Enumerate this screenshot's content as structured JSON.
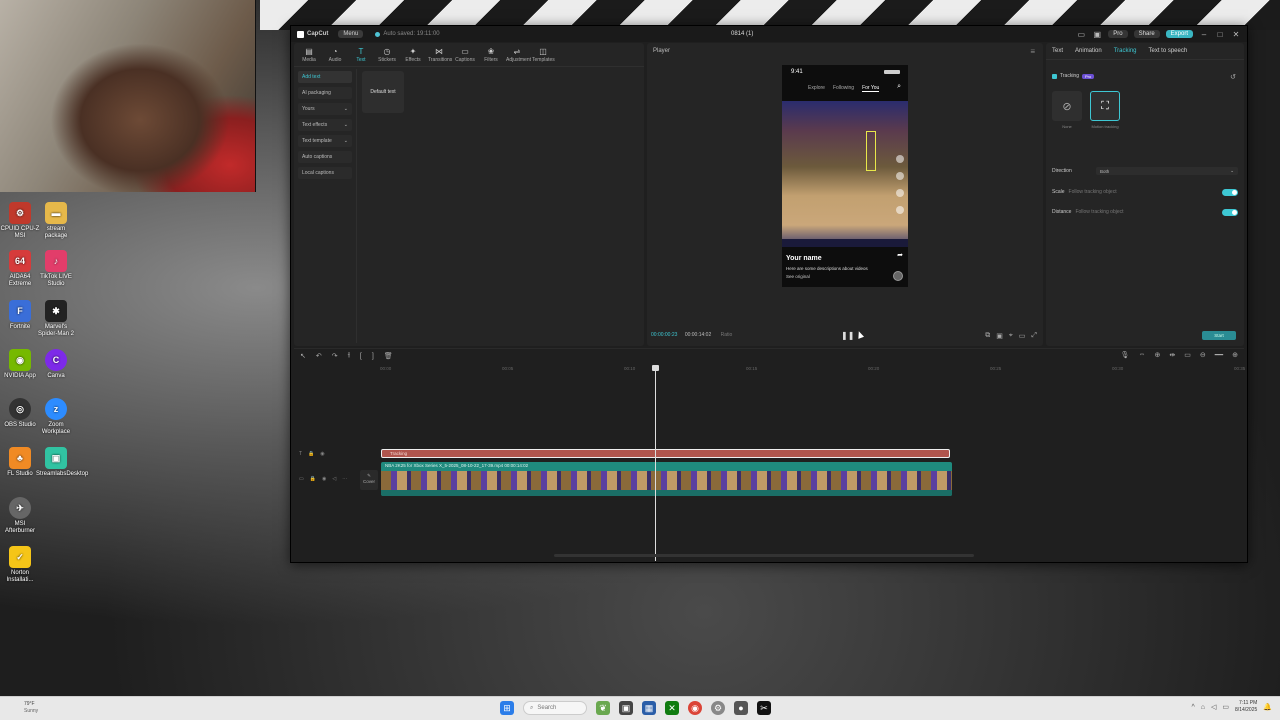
{
  "desktop": {
    "icons": [
      {
        "label": "CPUID CPU-Z MSI",
        "icon": "cpuz-icon",
        "color": "#c0392b"
      },
      {
        "label": "stream package",
        "icon": "folder-icon",
        "color": "#e6b84a"
      },
      {
        "label": "AIDA64 Extreme",
        "icon": "aida64-icon",
        "color": "#d63b3b"
      },
      {
        "label": "TikTok LIVE Studio",
        "icon": "tiktok-icon",
        "color": "#e23d6a"
      },
      {
        "label": "Fortnite",
        "icon": "fortnite-icon",
        "color": "#3a6ed8"
      },
      {
        "label": "Marvel's Spider-Man 2",
        "icon": "spiderman-icon",
        "color": "#222222"
      },
      {
        "label": "NVIDIA App",
        "icon": "nvidia-icon",
        "color": "#76b900"
      },
      {
        "label": "Canva",
        "icon": "canva-icon",
        "color": "#7d2ae8"
      },
      {
        "label": "OBS Studio",
        "icon": "obs-icon",
        "color": "#333333"
      },
      {
        "label": "Zoom Workplace",
        "icon": "zoom-icon",
        "color": "#2d8cff"
      },
      {
        "label": "FL Studio",
        "icon": "flstudio-icon",
        "color": "#f08a24"
      },
      {
        "label": "StreamlabsDesktop",
        "icon": "streamlabs-icon",
        "color": "#31c3a2"
      },
      {
        "label": "MSI Afterburner",
        "icon": "afterburner-icon",
        "color": "#666666"
      },
      {
        "label": "Norton Installati...",
        "icon": "norton-icon",
        "color": "#f5c518"
      }
    ]
  },
  "capcut": {
    "app_name": "CapCut",
    "menu_label": "Menu",
    "autosave": "Auto saved: 19:11:00",
    "project_title": "0814 (1)",
    "pro_label": "Pro",
    "share_label": "Share",
    "export_label": "Export",
    "toolbar": [
      {
        "label": "Media",
        "icon": "media-icon"
      },
      {
        "label": "Audio",
        "icon": "audio-icon"
      },
      {
        "label": "Text",
        "icon": "text-icon",
        "active": true
      },
      {
        "label": "Stickers",
        "icon": "stickers-icon"
      },
      {
        "label": "Effects",
        "icon": "effects-icon"
      },
      {
        "label": "Transitions",
        "icon": "transitions-icon"
      },
      {
        "label": "Captions",
        "icon": "captions-icon"
      },
      {
        "label": "Filters",
        "icon": "filters-icon"
      },
      {
        "label": "Adjustment",
        "icon": "adjustment-icon"
      },
      {
        "label": "Templates",
        "icon": "templates-icon"
      }
    ],
    "side_menu": [
      {
        "label": "Add text",
        "active": true,
        "arrow": ""
      },
      {
        "label": "AI packaging",
        "arrow": ""
      },
      {
        "label": "Yours",
        "arrow": "⌄"
      },
      {
        "label": "Text effects",
        "arrow": "⌄"
      },
      {
        "label": "Text template",
        "arrow": "⌄"
      },
      {
        "label": "Auto captions",
        "arrow": ""
      },
      {
        "label": "Local captions",
        "arrow": ""
      }
    ],
    "default_text_card": "Default text",
    "player": {
      "title": "Player",
      "phone_time": "9:41",
      "tabs": [
        "Explore",
        "Following",
        "For You"
      ],
      "caption_name": "Your name",
      "caption_desc": "Here are some descriptions about videos",
      "caption_orig": "See original",
      "current_time": "00:00:00:23",
      "total_time": "00:00:14:02",
      "ratio": "Ratio"
    },
    "right_panel": {
      "tabs": [
        "Text",
        "Animation",
        "Tracking",
        "Text to speech"
      ],
      "active_tab": "Tracking",
      "tracking_label": "Tracking",
      "pro_badge": "Pro",
      "options": [
        {
          "label": "None",
          "icon": "none-icon"
        },
        {
          "label": "Motion tracking",
          "icon": "motion-tracking-icon",
          "selected": true
        }
      ],
      "direction_label": "Direction",
      "direction_value": "Both",
      "scale_label": "Scale",
      "scale_sub": "Follow tracking object",
      "distance_label": "Distance",
      "distance_sub": "Follow tracking object",
      "start_button": "Start"
    },
    "timeline": {
      "ruler_ticks": [
        "00:00",
        "00:05",
        "00:10",
        "00:15",
        "00:20",
        "00:25",
        "00:30",
        "00:35"
      ],
      "tracking_clip": "Tracking",
      "video_clip": "NBA 2K25 for Xbox Series X_5-2025_08-10-22_17-39.mp4  00:00:14:02",
      "cover_label": "Cover"
    }
  },
  "taskbar": {
    "weather_temp": "79°F",
    "weather_desc": "Sunny",
    "search_placeholder": "Search",
    "time": "7:11 PM",
    "date": "8/14/2025"
  }
}
